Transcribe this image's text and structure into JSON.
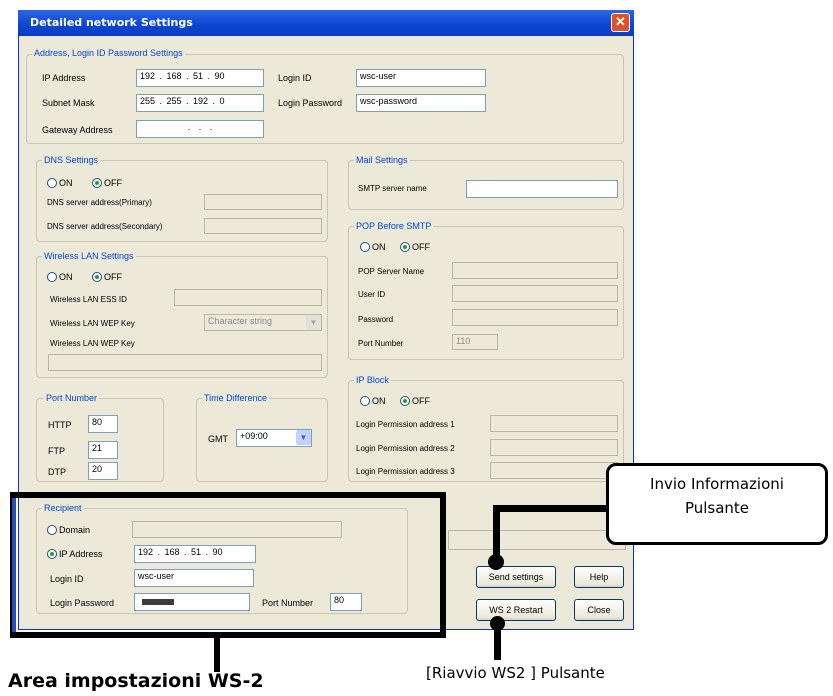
{
  "window": {
    "title": "Detailed network Settings",
    "close": "✕"
  },
  "address_group": {
    "title": "Address, Login ID Password Settings",
    "ip_label": "IP Address",
    "ip_value": "192 . 168 . 51 . 90",
    "subnet_label": "Subnet Mask",
    "subnet_value": "255 . 255 . 192 . 0",
    "gateway_label": "Gateway Address",
    "gateway_value": ".    .    .",
    "login_id_label": "Login ID",
    "login_id_value": "wsc-user",
    "login_pw_label": "Login Password",
    "login_pw_value": "wsc-password"
  },
  "dns": {
    "title": "DNS Settings",
    "on": "ON",
    "off": "OFF",
    "primary_label": "DNS server address(Primary)",
    "secondary_label": "DNS server address(Secondary)"
  },
  "mail": {
    "title": "Mail Settings",
    "smtp_label": "SMTP server name"
  },
  "pop": {
    "title": "POP Before SMTP",
    "on": "ON",
    "off": "OFF",
    "server_label": "POP Server Name",
    "user_label": "User ID",
    "password_label": "Password",
    "port_label": "Port Number",
    "port_value": "110"
  },
  "wlan": {
    "title": "Wireless LAN Settings",
    "on": "ON",
    "off": "OFF",
    "essid_label": "Wireless LAN ESS ID",
    "wepkey_label": "Wireless LAN WEP Key",
    "wepkey_select": "Character string",
    "wepkey2_label": "Wireless LAN WEP Key"
  },
  "ports": {
    "title": "Port Number",
    "http_label": "HTTP",
    "http_value": "80",
    "ftp_label": "FTP",
    "ftp_value": "21",
    "dtp_label": "DTP",
    "dtp_value": "20"
  },
  "time": {
    "title": "Time Difference",
    "gmt_label": "GMT",
    "gmt_value": "+09:00"
  },
  "ipblock": {
    "title": "IP Block",
    "on": "ON",
    "off": "OFF",
    "addr1_label": "Login Permission address 1",
    "addr2_label": "Login Permission address 2",
    "addr3_label": "Login Permission address 3"
  },
  "recipient": {
    "title": "Recipient",
    "domain_label": "Domain",
    "ip_label": "IP Address",
    "ip_value": "192 . 168 . 51 . 90",
    "login_id_label": "Login ID",
    "login_id_value": "wsc-user",
    "login_pw_label": "Login Password",
    "port_label": "Port Number",
    "port_value": "80"
  },
  "buttons": {
    "send": "Send settings",
    "help": "Help",
    "restart": "WS 2 Restart",
    "close": "Close"
  },
  "annotations": {
    "send_callout_line1": "Invio Informazioni",
    "send_callout_line2": "Pulsante",
    "restart_caption": "[Riavvio WS2  ] Pulsante",
    "area_caption": "Area impostazioni WS-2"
  }
}
